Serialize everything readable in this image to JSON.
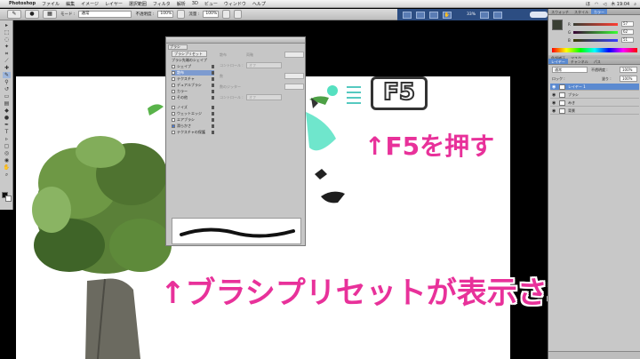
{
  "menubar": {
    "apple": "",
    "app_name": "Photoshop",
    "items": [
      "ファイル",
      "編集",
      "イメージ",
      "レイヤー",
      "選択範囲",
      "フィルタ",
      "解析",
      "3D",
      "ビュー",
      "ウィンドウ",
      "ヘルプ"
    ],
    "clock": "木 19:04",
    "status": "ほ"
  },
  "options_bar": {
    "mode_label": "モード :",
    "mode_value": "通常",
    "opacity_label": "不透明度 :",
    "opacity_value": "100%",
    "flow_label": "流量 :",
    "flow_value": "100%"
  },
  "app_bar": {
    "zoom": "33%"
  },
  "brush_panel": {
    "tab_label": "ブラシ",
    "preset_button": "ブラシプリセット",
    "shape_label": "ブラシ先端のシェイプ",
    "options": [
      {
        "label": "シェイプ",
        "checked": false,
        "selected": false
      },
      {
        "label": "散布",
        "checked": false,
        "selected": true
      },
      {
        "label": "テクスチャ",
        "checked": false,
        "selected": false
      },
      {
        "label": "デュアルブラシ",
        "checked": false,
        "selected": false
      },
      {
        "label": "カラー",
        "checked": false,
        "selected": false
      },
      {
        "label": "その他",
        "checked": false,
        "selected": false
      },
      {
        "label": "ノイズ",
        "checked": false,
        "selected": false
      },
      {
        "label": "ウェットエッジ",
        "checked": false,
        "selected": false
      },
      {
        "label": "エアブラシ",
        "checked": false,
        "selected": false
      },
      {
        "label": "滑らかさ",
        "checked": true,
        "selected": false
      },
      {
        "label": "テクスチャの保護",
        "checked": false,
        "selected": false
      }
    ],
    "right_rows": [
      {
        "label": "散布",
        "extra": "両軸"
      },
      {
        "label": "コントロール :",
        "dropdown": "オフ"
      },
      {
        "label": "数",
        "extra": ""
      },
      {
        "label": "数のジッター",
        "extra": ""
      },
      {
        "label": "コントロール :",
        "dropdown": "オフ"
      }
    ]
  },
  "color_panel": {
    "tabs": [
      "カラー",
      "スウォッチ",
      "スタイル"
    ],
    "channels": [
      {
        "name": "R",
        "value": "57"
      },
      {
        "name": "G",
        "value": "62"
      },
      {
        "name": "B",
        "value": "51"
      }
    ]
  },
  "adjust_tabs": [
    "色調補正",
    "マスク"
  ],
  "layers_panel": {
    "tabs": [
      "レイヤー",
      "チャンネル",
      "パス"
    ],
    "blend_mode": "通常",
    "opacity_label": "不透明度 :",
    "opacity_value": "100%",
    "lock_label": "ロック :",
    "fill_label": "塗り :",
    "fill_value": "100%",
    "layers": [
      {
        "name": "レイヤー 1",
        "active": true
      },
      {
        "name": "ブラシ",
        "active": false
      },
      {
        "name": "みき",
        "active": false
      },
      {
        "name": "背景",
        "active": false
      }
    ]
  },
  "annotations": {
    "f5_key": "F5",
    "press_f5": "↑F5を押す",
    "preset_shown": "↑ブラシプリセットが表示される"
  }
}
